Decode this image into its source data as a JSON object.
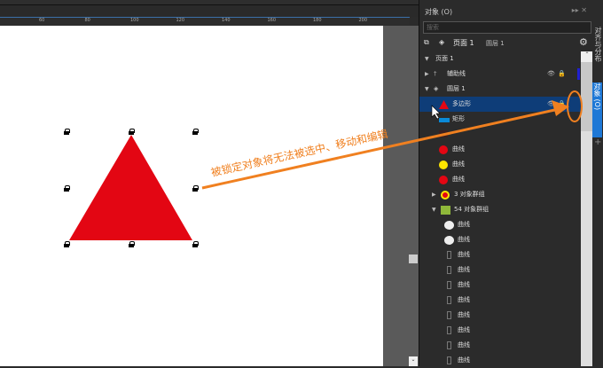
{
  "ruler": {
    "labels": [
      "60",
      "80",
      "100",
      "120",
      "140",
      "160",
      "180",
      "200"
    ]
  },
  "panel": {
    "title": "对象 (O)",
    "search_placeholder": "搜索",
    "page_label": "页面 1",
    "layer_label": "圆层 1",
    "side_tabs": [
      "对齐与分布",
      "对象 (O)"
    ],
    "items": [
      {
        "label": "页面 1",
        "indent": 0,
        "arrow": "▼",
        "icon": "none"
      },
      {
        "label": "辅助线",
        "indent": 0,
        "arrow": "▶",
        "icon": "guides",
        "eye": true,
        "lock": true,
        "color": "#2020d0"
      },
      {
        "label": "圆层 1",
        "indent": 0,
        "arrow": "▼",
        "icon": "layer"
      },
      {
        "label": "多边形",
        "indent": 1,
        "icon": "triangle",
        "eye": true,
        "lock": true,
        "selected": true
      },
      {
        "label": "矩形",
        "indent": 1,
        "icon": "rect"
      },
      {
        "label": "",
        "indent": 1,
        "icon": "dark"
      },
      {
        "label": "曲线",
        "indent": 1,
        "icon": "red"
      },
      {
        "label": "曲线",
        "indent": 1,
        "icon": "yellow"
      },
      {
        "label": "曲线",
        "indent": 1,
        "icon": "red"
      },
      {
        "label": "3 对象群组",
        "indent": 1,
        "arrow": "▶",
        "icon": "group3"
      },
      {
        "label": "54 对象群组",
        "indent": 1,
        "arrow": "▼",
        "icon": "group54"
      },
      {
        "label": "曲线",
        "indent": 2,
        "icon": "white"
      },
      {
        "label": "曲线",
        "indent": 2,
        "icon": "white"
      },
      {
        "label": "曲线",
        "indent": 2,
        "icon": "diamond"
      },
      {
        "label": "曲线",
        "indent": 2,
        "icon": "diamond"
      },
      {
        "label": "曲线",
        "indent": 2,
        "icon": "diamond"
      },
      {
        "label": "曲线",
        "indent": 2,
        "icon": "diamond"
      },
      {
        "label": "曲线",
        "indent": 2,
        "icon": "diamond"
      },
      {
        "label": "曲线",
        "indent": 2,
        "icon": "diamond"
      },
      {
        "label": "曲线",
        "indent": 2,
        "icon": "diamond"
      },
      {
        "label": "曲线",
        "indent": 2,
        "icon": "diamond"
      }
    ]
  },
  "annotation": {
    "text": "被锁定对象将无法被选中、移动和编辑",
    "color": "#f08020"
  },
  "colors": {
    "triangle": "#e30613",
    "selection": "#0e3d78",
    "accent": "#1e78d6"
  }
}
